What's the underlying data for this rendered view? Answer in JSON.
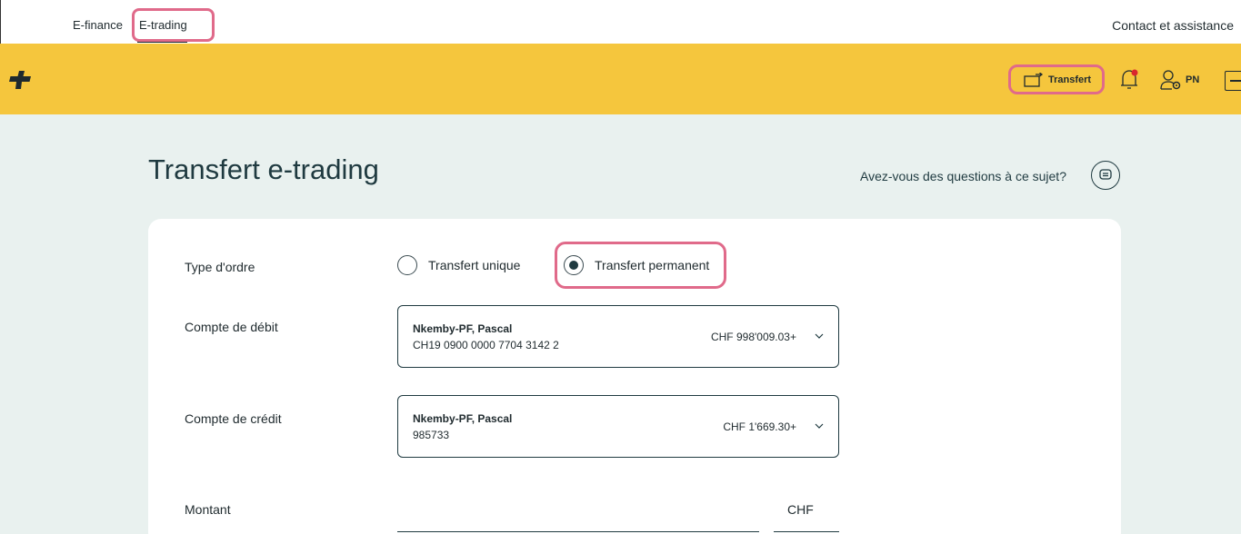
{
  "topbar": {
    "tabs": [
      "E-finance",
      "E-trading"
    ],
    "contact": "Contact et assistance"
  },
  "header": {
    "transfer_label": "Transfert",
    "user_initials": "PN"
  },
  "page": {
    "title": "Transfert e-trading",
    "help_text": "Avez-vous des questions à ce sujet?"
  },
  "form": {
    "order_type_label": "Type d'ordre",
    "order_types": [
      {
        "label": "Transfert unique",
        "selected": false
      },
      {
        "label": "Transfert permanent",
        "selected": true
      }
    ],
    "debit_label": "Compte de débit",
    "debit_account": {
      "name": "Nkemby-PF, Pascal",
      "number": "CH19 0900 0000 7704 3142 2",
      "balance": "CHF 998'009.03+"
    },
    "credit_label": "Compte de crédit",
    "credit_account": {
      "name": "Nkemby-PF, Pascal",
      "number": "985733",
      "balance": "CHF 1'669.30+"
    },
    "amount_label": "Montant",
    "currency": "CHF"
  },
  "colors": {
    "header_bg": "#f5c63d",
    "page_bg": "#e9f1ef",
    "highlight": "#e06a8a",
    "text_dark": "#1f3a40"
  }
}
